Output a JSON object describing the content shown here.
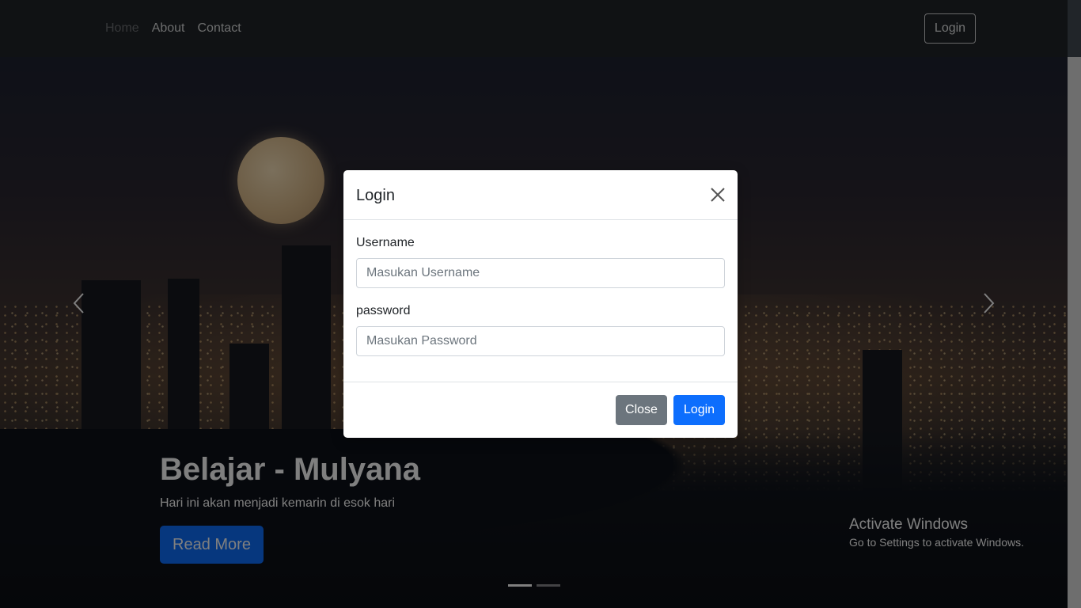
{
  "navbar": {
    "links": [
      "Home",
      "About",
      "Contact"
    ],
    "login_button": "Login"
  },
  "hero": {
    "title": "Belajar - Mulyana",
    "subtitle": "Hari ini akan menjadi kemarin di esok hari",
    "cta_label": "Read More",
    "slide_count": 2,
    "active_slide": 1
  },
  "modal": {
    "title": "Login",
    "username_label": "Username",
    "username_placeholder": "Masukan Username",
    "username_value": "",
    "password_label": "password",
    "password_placeholder": "Masukan Password",
    "password_value": "",
    "close_button": "Close",
    "login_button": "Login"
  },
  "watermark": {
    "title": "Activate Windows",
    "subtitle": "Go to Settings to activate Windows."
  },
  "icons": {
    "modal_close": "close-icon",
    "carousel_prev": "chevron-left-icon",
    "carousel_next": "chevron-right-icon"
  },
  "colors": {
    "navbar_bg": "#212529",
    "primary": "#0d6efd",
    "secondary": "#6c757d"
  }
}
